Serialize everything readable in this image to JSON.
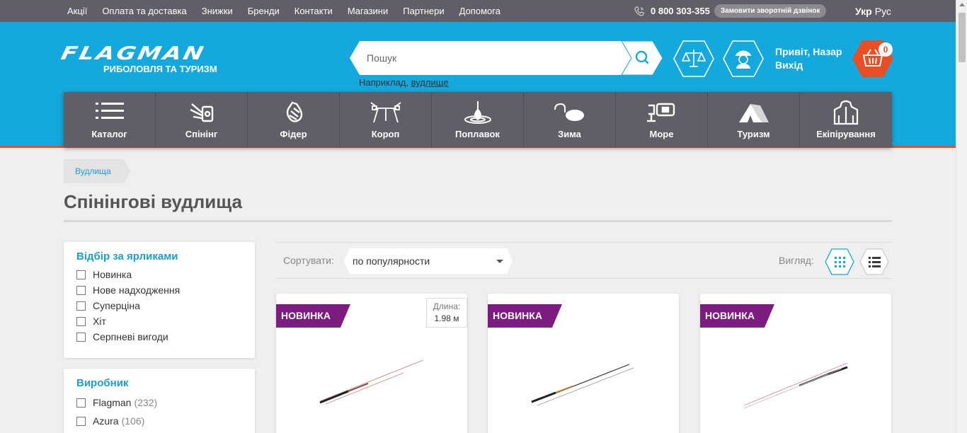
{
  "topbar": {
    "links": [
      "Акції",
      "Оплата та доставка",
      "Знижки",
      "Бренди",
      "Контакти",
      "Магазини",
      "Партнери",
      "Допомога"
    ],
    "phone": "0 800 303-355",
    "callback": "Замовити зворотній дзвінок",
    "lang_active": "Укр",
    "lang_other": "Рус"
  },
  "header": {
    "logo_word": "FLAGMAN",
    "logo_sub": "РИБОЛОВЛЯ ТА ТУРИЗМ",
    "search_placeholder": "Пошук",
    "search_hint_prefix": "Наприклад,",
    "search_hint_link": "вудлище",
    "greeting": "Привіт, Назар",
    "logout": "Вихід",
    "cart_count": "0"
  },
  "categories": [
    {
      "label": "Каталог",
      "icon": "list-icon"
    },
    {
      "label": "Спінінг",
      "icon": "spinning-reel-icon"
    },
    {
      "label": "Фідер",
      "icon": "feeder-icon"
    },
    {
      "label": "Короп",
      "icon": "rod-pod-icon"
    },
    {
      "label": "Поплавок",
      "icon": "float-icon"
    },
    {
      "label": "Зима",
      "icon": "ice-lure-icon"
    },
    {
      "label": "Море",
      "icon": "sea-reel-icon"
    },
    {
      "label": "Туризм",
      "icon": "tent-icon"
    },
    {
      "label": "Екіпірування",
      "icon": "jacket-icon"
    }
  ],
  "breadcrumb": [
    "Вудлища"
  ],
  "page_title": "Спінінгові вудлища",
  "filters": {
    "tags_title": "Відбір за ярликами",
    "tags": [
      "Новинка",
      "Нове надходження",
      "Суперціна",
      "Хіт",
      "Серпневі вигоди"
    ],
    "maker_title": "Виробник",
    "makers": [
      {
        "name": "Flagman",
        "count": "(232)"
      },
      {
        "name": "Azura",
        "count": "(106)"
      }
    ]
  },
  "sorting": {
    "label": "Сортувати:",
    "selected": "по популярности",
    "view_label": "Вигляд:"
  },
  "products": [
    {
      "badge": "НОВИНКА",
      "length_label": "Длина:",
      "length_value": "1.98 м"
    },
    {
      "badge": "НОВИНКА"
    },
    {
      "badge": "НОВИНКА"
    }
  ],
  "colors": {
    "accent_blue": "#14a8dc",
    "dark_bar": "#5f6067",
    "orange": "#e94e24",
    "badge_purple": "#7b1c7e"
  }
}
